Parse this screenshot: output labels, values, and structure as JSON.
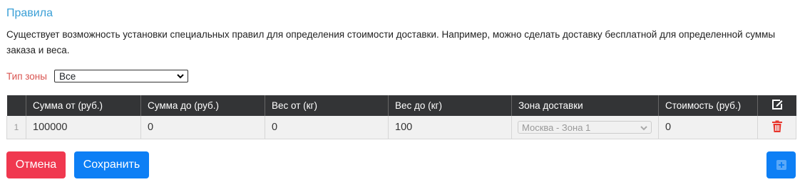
{
  "section": {
    "title": "Правила",
    "description": "Существует возможность установки специальных правил для определения стоимости доставки. Например, можно сделать доставку бесплатной для определенной суммы заказа и веса."
  },
  "zone_filter": {
    "label": "Тип зоны",
    "selected": "Все"
  },
  "table": {
    "columns": [
      "",
      "Сумма от (руб.)",
      "Сумма до (руб.)",
      "Вес от (кг)",
      "Вес до (кг)",
      "Зона доставки",
      "Стоимость (руб.)"
    ],
    "rows": [
      {
        "num": "1",
        "sum_from": "100000",
        "sum_to": "0",
        "weight_from": "0",
        "weight_to": "100",
        "zone": "Москва - Зона 1",
        "cost": "0"
      }
    ]
  },
  "buttons": {
    "cancel": "Отмена",
    "save": "Сохранить"
  },
  "icons": {
    "header_action": "edit-icon",
    "row_action": "trash-icon",
    "add": "plus-square-icon"
  },
  "colors": {
    "title": "#3a9fd6",
    "zone_label": "#d9534f",
    "header_bg": "#333436",
    "cancel": "#f0384f",
    "primary": "#0d7ff5",
    "trash": "#e8352c"
  }
}
